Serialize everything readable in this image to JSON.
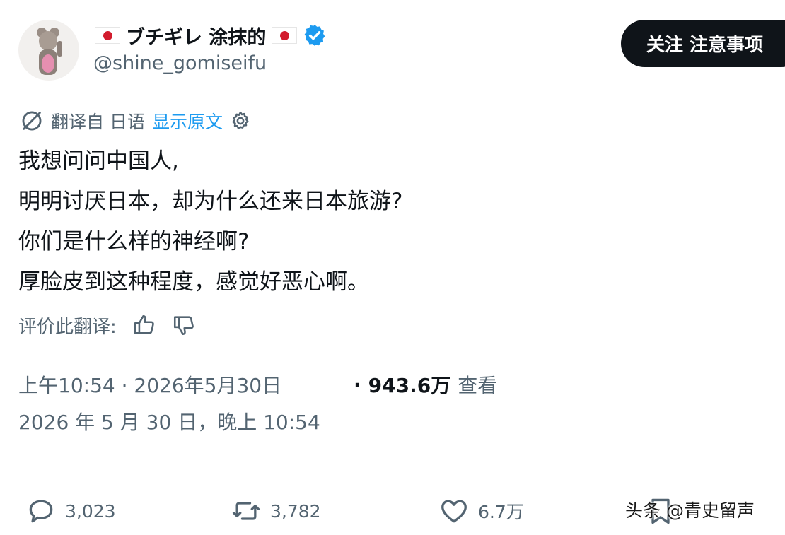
{
  "profile": {
    "display_name": "ブチギレ 涂抹的",
    "handle": "@shine_gomiseifu",
    "verified": true,
    "flag_icon": "japan-flag-icon"
  },
  "follow_button": {
    "label": "关注 注意事项"
  },
  "translation": {
    "from_label": "翻译自 日语",
    "show_original": "显示原文",
    "icon": "translate-icon",
    "settings_icon": "gear-icon"
  },
  "tweet": {
    "lines": [
      "我想问问中国人,",
      "明明讨厌日本，却为什么还来日本旅游?",
      "你们是什么样的神经啊?",
      "厚脸皮到这种程度，感觉好恶心啊。"
    ]
  },
  "rate": {
    "label": "评价此翻译:"
  },
  "meta": {
    "timestamp": "上午10:54 · 2026年5月30日",
    "views_prefix": "·",
    "views_count": "943.6万",
    "views_label": "查看",
    "date_line": "2026 年 5 月 30 日，晚上 10:54"
  },
  "actions": {
    "replies": "3,023",
    "retweets": "3,782",
    "likes": "6.7万"
  },
  "watermark": {
    "text": "头条 @青史留声"
  },
  "colors": {
    "text": "#0f1419",
    "secondary": "#536471",
    "link": "#1d9bf0",
    "verified": "#1d9bf0",
    "button_bg": "#0f1419"
  }
}
